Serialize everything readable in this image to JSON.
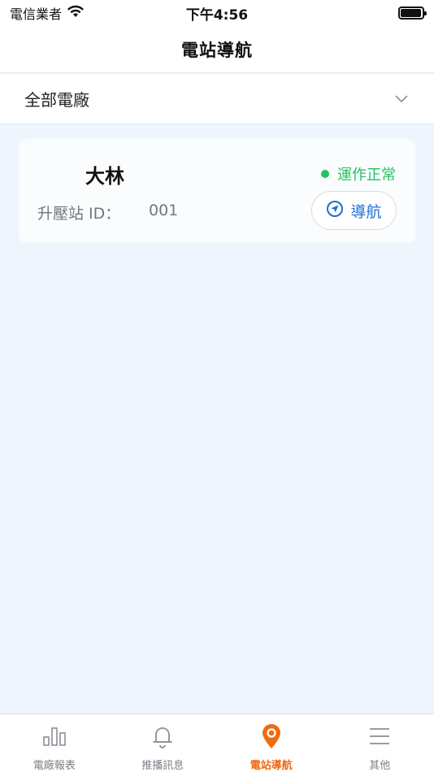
{
  "status_bar": {
    "carrier": "電信業者",
    "time": "下午4:56",
    "battery_level": 0.95
  },
  "header": {
    "title": "電站導航"
  },
  "filter": {
    "selected": "全部電廠"
  },
  "stations": [
    {
      "name": "大林",
      "status": "運作正常",
      "id_label": "升壓站 ID：",
      "id_value": "001",
      "navigate_label": "導航"
    }
  ],
  "tab_bar": {
    "tabs": [
      {
        "label": "電廠報表",
        "icon": "bar-chart-icon",
        "active": false
      },
      {
        "label": "推播訊息",
        "icon": "bell-icon",
        "active": false
      },
      {
        "label": "電站導航",
        "icon": "map-pin-icon",
        "active": true
      },
      {
        "label": "其他",
        "icon": "menu-icon",
        "active": false
      }
    ]
  },
  "colors": {
    "accent": "#f06a10",
    "status_ok": "#22c35e",
    "link_blue": "#1f6fd4",
    "content_bg": "#eef5fd"
  }
}
